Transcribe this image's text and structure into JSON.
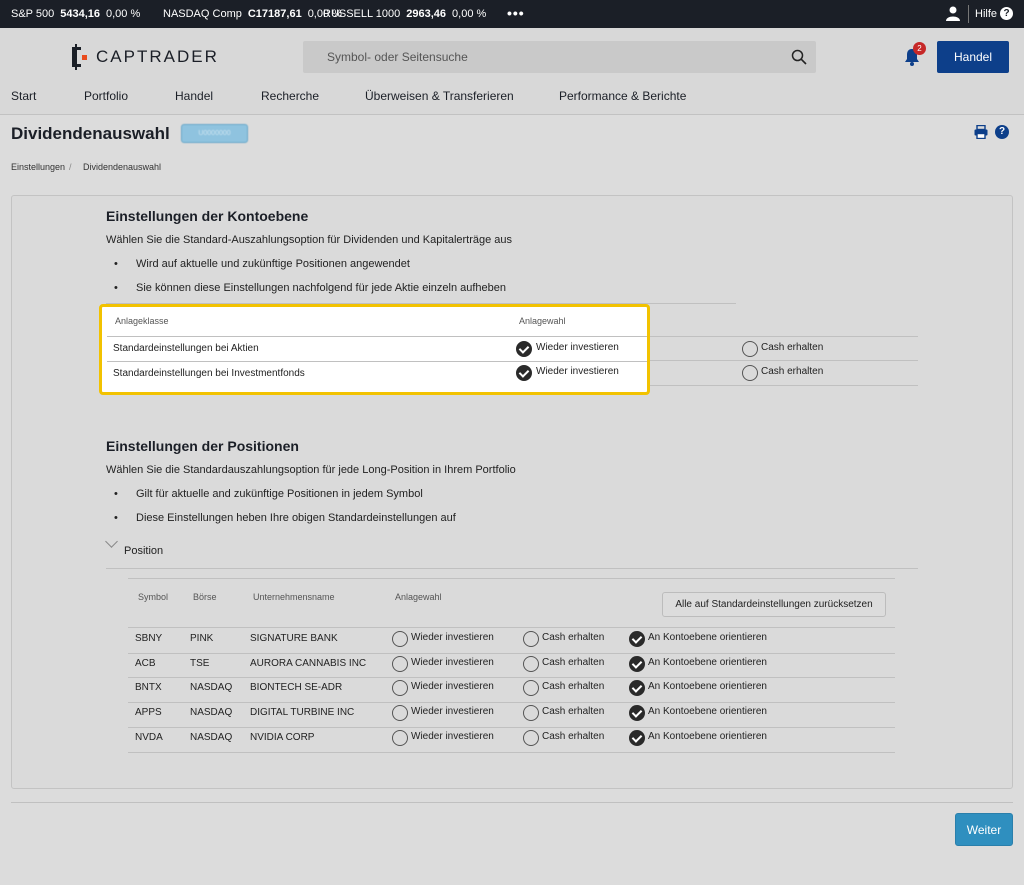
{
  "ticker": {
    "items": [
      {
        "name": "S&P 500",
        "value": "5434,16",
        "change": "0,00 %"
      },
      {
        "name": "NASDAQ Comp",
        "value": "C17187,61",
        "change": "0,00 %"
      },
      {
        "name": "RUSSELL 1000",
        "value": "2963,46",
        "change": "0,00 %"
      }
    ],
    "more": "•••",
    "help_label": "Hilfe",
    "help_icon": "?"
  },
  "header": {
    "logo_text": "CAPTRADER",
    "search_placeholder": "Symbol- oder Seitensuche",
    "notification_count": "2",
    "trade_button": "Handel"
  },
  "nav": [
    "Start",
    "Portfolio",
    "Handel",
    "Recherche",
    "Überweisen & Transferieren",
    "Performance & Berichte"
  ],
  "page": {
    "title": "Dividendenauswahl",
    "account_chip": "U0000000",
    "help_icon": "?",
    "breadcrumb": [
      "Einstellungen",
      "/",
      "Dividendenauswahl"
    ]
  },
  "account_section": {
    "heading": "Einstellungen der Kontoebene",
    "intro": "Wählen Sie die Standard-Auszahlungsoption für Dividenden und Kapitalerträge aus",
    "bullets": [
      "Wird auf aktuelle und zukünftige Positionen angewendet",
      "Sie können diese Einstellungen nachfolgend für jede Aktie einzeln aufheben"
    ],
    "columns": [
      "Anlageklasse",
      "Anlagewahl"
    ],
    "rows": [
      {
        "class": "Standardeinstellungen bei Aktien",
        "opt1": "Wieder investieren",
        "opt2": "Cash erhalten",
        "selected": "opt1"
      },
      {
        "class": "Standardeinstellungen bei Investmentfonds",
        "opt1": "Wieder investieren",
        "opt2": "Cash erhalten",
        "selected": "opt1"
      }
    ]
  },
  "position_section": {
    "heading": "Einstellungen der Positionen",
    "intro": "Wählen Sie die Standardauszahlungsoption für jede Long-Position in Ihrem Portfolio",
    "bullets": [
      "Gilt für aktuelle and zukünftige Positionen in jedem Symbol",
      "Diese Einstellungen heben Ihre obigen Standardeinstellungen auf"
    ],
    "accordion_label": "Position",
    "columns": [
      "Symbol",
      "Börse",
      "Unternehmensname",
      "Anlagewahl"
    ],
    "reset_button": "Alle auf Standardeinstellungen zurücksetzen",
    "option_labels": [
      "Wieder investieren",
      "Cash erhalten",
      "An Kontoebene orientieren"
    ],
    "rows": [
      {
        "symbol": "SBNY",
        "exchange": "PINK",
        "company": "SIGNATURE BANK",
        "selected": 2
      },
      {
        "symbol": "ACB",
        "exchange": "TSE",
        "company": "AURORA CANNABIS INC",
        "selected": 2
      },
      {
        "symbol": "BNTX",
        "exchange": "NASDAQ",
        "company": "BIONTECH SE-ADR",
        "selected": 2
      },
      {
        "symbol": "APPS",
        "exchange": "NASDAQ",
        "company": "DIGITAL TURBINE INC",
        "selected": 2
      },
      {
        "symbol": "NVDA",
        "exchange": "NASDAQ",
        "company": "NVIDIA CORP",
        "selected": 2
      }
    ]
  },
  "footer": {
    "next_button": "Weiter"
  }
}
